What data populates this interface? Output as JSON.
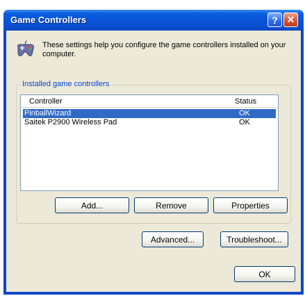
{
  "window": {
    "title": "Game Controllers",
    "help_glyph": "?",
    "close_glyph": "✕"
  },
  "intro_text": "These settings help you configure the game controllers installed on your computer.",
  "group_label": "Installed game controllers",
  "list": {
    "columns": [
      "Controller",
      "Status"
    ],
    "rows": [
      {
        "name": "PinballWizard",
        "status": "OK",
        "selected": true
      },
      {
        "name": "Saitek P2900 Wireless Pad",
        "status": "OK",
        "selected": false
      }
    ]
  },
  "buttons": {
    "add": "Add...",
    "remove": "Remove",
    "properties": "Properties",
    "advanced": "Advanced...",
    "troubleshoot": "Troubleshoot...",
    "ok": "OK"
  },
  "colors": {
    "title_bar": "#0854d6",
    "selection": "#316ac5",
    "dialog_face": "#ece9d8",
    "ok_highlight": "#fdfbe0"
  },
  "icons": {
    "intro": "gamepad-icon"
  }
}
